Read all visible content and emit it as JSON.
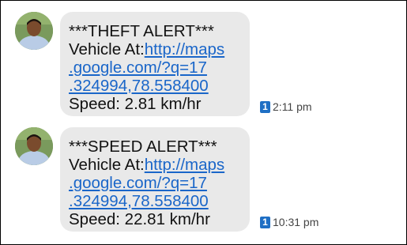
{
  "messages": [
    {
      "alert": "***THEFT ALERT***",
      "vehicle_prefix": "Vehicle At:",
      "link_lines": [
        "http://maps",
        ".google.com/?q=17",
        ".324994,78.558400"
      ],
      "speed": "Speed: 2.81 km/hr",
      "sim": "1",
      "time": "2:11 pm"
    },
    {
      "alert": "***SPEED ALERT***",
      "vehicle_prefix": "Vehicle At:",
      "link_lines": [
        "http://maps",
        ".google.com/?q=17",
        ".324994,78.558400"
      ],
      "speed": "Speed: 22.81 km/hr",
      "sim": "1",
      "time": "10:31 pm"
    }
  ],
  "colors": {
    "bubble": "#e9e9e9",
    "link": "#1a66c9",
    "sim_badge": "#1f6fc4"
  },
  "icons": {
    "avatar": "contact-avatar-icon",
    "sim": "sim-1-icon"
  }
}
